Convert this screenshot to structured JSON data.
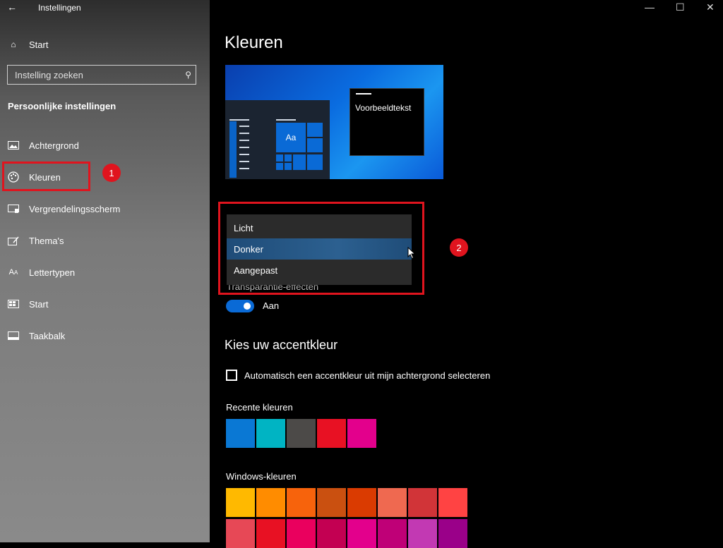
{
  "app": {
    "title": "Instellingen"
  },
  "sidebar": {
    "home_label": "Start",
    "search_placeholder": "Instelling zoeken",
    "section_title": "Persoonlijke instellingen",
    "items": [
      {
        "label": "Achtergrond",
        "icon": "image-icon"
      },
      {
        "label": "Kleuren",
        "icon": "palette-icon"
      },
      {
        "label": "Vergrendelingsscherm",
        "icon": "lock-screen-icon"
      },
      {
        "label": "Thema's",
        "icon": "theme-icon"
      },
      {
        "label": "Lettertypen",
        "icon": "font-icon"
      },
      {
        "label": "Start",
        "icon": "start-icon"
      },
      {
        "label": "Taakbalk",
        "icon": "taskbar-icon"
      }
    ]
  },
  "annotations": {
    "badge1": "1",
    "badge2": "2",
    "color": "#e0141e"
  },
  "main": {
    "title": "Kleuren",
    "preview": {
      "sample_text": "Voorbeeldtekst",
      "tile_text": "Aa"
    },
    "mode_dropdown": {
      "options": [
        "Licht",
        "Donker",
        "Aangepast"
      ],
      "selected": "Donker"
    },
    "transparency": {
      "label": "Transparantie-effecten",
      "state": "Aan",
      "on": true
    },
    "accent": {
      "title": "Kies uw accentkleur",
      "auto_checkbox_label": "Automatisch een accentkleur uit mijn achtergrond selecteren",
      "auto_checked": false,
      "recent_label": "Recente kleuren",
      "recent_colors": [
        "#0a78d4",
        "#00b4c3",
        "#4c4a48",
        "#e81123",
        "#e3008c"
      ],
      "windows_label": "Windows-kleuren",
      "windows_colors_row1": [
        "#ffb900",
        "#ff8c00",
        "#f7630c",
        "#ca5010",
        "#da3b01",
        "#ef6950",
        "#d13438",
        "#ff4343"
      ],
      "windows_colors_row2": [
        "#e74856",
        "#e81123",
        "#ea005e",
        "#c30052",
        "#e3008c",
        "#bf0077",
        "#c239b3",
        "#9a0089"
      ]
    }
  },
  "window_controls": {
    "minimize": "—",
    "maximize": "☐",
    "close": "✕"
  }
}
